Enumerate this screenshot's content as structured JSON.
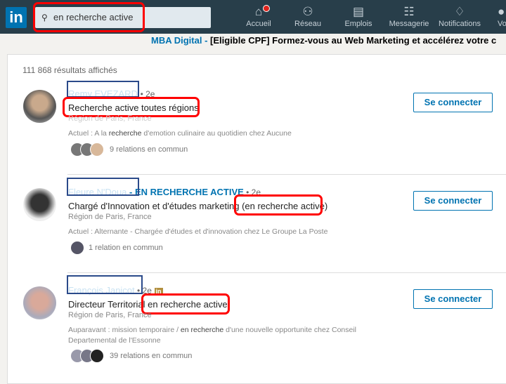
{
  "nav": {
    "search_value": "en recherche active",
    "items": [
      {
        "label": "Accueil",
        "icon": "home-icon"
      },
      {
        "label": "Réseau",
        "icon": "network-icon"
      },
      {
        "label": "Emplois",
        "icon": "briefcase-icon"
      },
      {
        "label": "Messagerie",
        "icon": "message-icon"
      },
      {
        "label": "Notifications",
        "icon": "bell-icon"
      },
      {
        "label": "Vo",
        "icon": "avatar-icon"
      }
    ]
  },
  "ad": {
    "brand": "MBA Digital",
    "sep": " - ",
    "text": "[Eligible CPF] Formez-vous au Web Marketing et accélérez votre c"
  },
  "results_count": "111 868 résultats affichés",
  "results": [
    {
      "name": "Remy EVEZARD",
      "tag": "",
      "degree": "• 2e",
      "headline": "Recherche active toutes régions",
      "location": "Région de Paris, France",
      "desc_pre": "Actuel : A la ",
      "desc_hl": "recherche",
      "desc_post": " d'emotion culinaire au quotidien chez Aucune",
      "relations": "9 relations en commun",
      "connect": "Se connecter"
    },
    {
      "name": "Fleure N'Doua",
      "tag": " - EN RECHERCHE ACTIVE",
      "degree": " • 2e",
      "headline": "Chargé d'Innovation et d'études marketing (en recherche active)",
      "location": "Région de Paris, France",
      "desc_pre": "Actuel : Alternante - Chargée d'études et d'innovation chez Le Groupe La Poste",
      "desc_hl": "",
      "desc_post": "",
      "relations": "1 relation en commun",
      "connect": "Se connecter"
    },
    {
      "name": "François Janicot",
      "tag": "",
      "degree": " • 2e",
      "headline": "Directeur Territorial en recherche active",
      "location": "Région de Paris, France",
      "desc_pre": "Auparavant : mission temporaire / ",
      "desc_hl": "en recherche",
      "desc_post": " d'une nouvelle opportunite chez Conseil Departemental de l'Essonne",
      "relations": "39 relations en commun",
      "connect": "Se connecter",
      "premium_badge": "in"
    }
  ]
}
